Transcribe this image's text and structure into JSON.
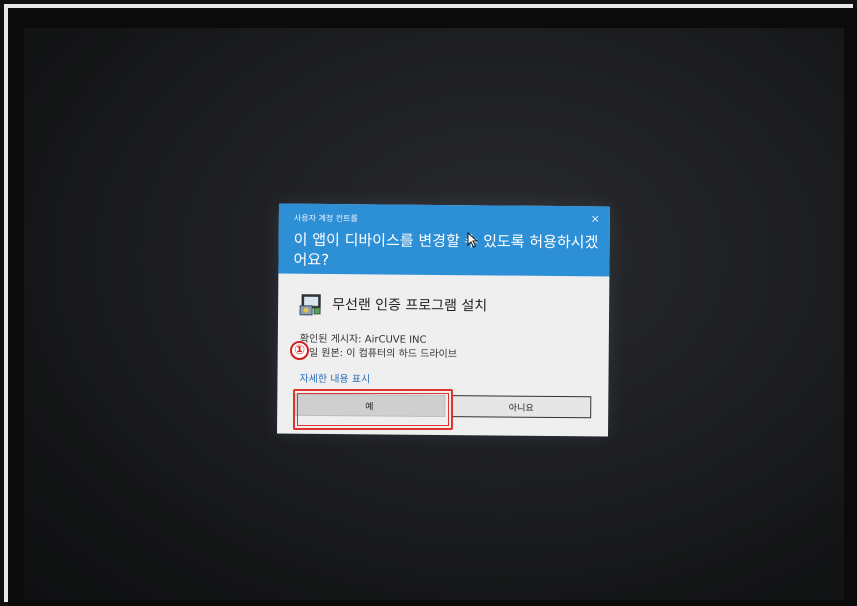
{
  "dialog": {
    "caption": "사용자 계정 컨트롤",
    "close_glyph": "×",
    "question": "이 앱이 디바이스를 변경할 수 있도록 허용하시겠어요?",
    "app_name": "무선랜 인증 프로그램 설치",
    "publisher": "확인된 게시자: AirCUVE INC",
    "origin": "파일 원본: 이 컴퓨터의 하드 드라이브",
    "details_link": "자세한 내용 표시",
    "yes_button": "예",
    "no_button": "아니요"
  },
  "annotation": {
    "step_marker": "①",
    "highlight_color": "#e0332f"
  },
  "colors": {
    "dialog_header": "#2d8fd6",
    "link": "#2b6fb8"
  },
  "icons": [
    "installer-icon",
    "close-icon",
    "mouse-cursor-icon"
  ]
}
